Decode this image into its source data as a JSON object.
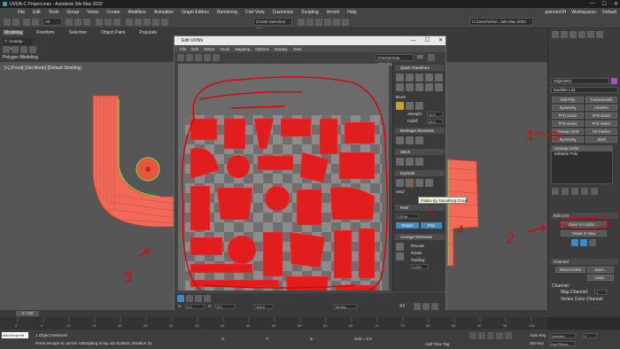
{
  "app": {
    "title": "UVDA-C Project.max - Autodesk 3ds Max 2022",
    "window_controls": [
      "—",
      "☐",
      "✕"
    ]
  },
  "menubar": {
    "items": [
      "File",
      "Edit",
      "Tools",
      "Group",
      "Views",
      "Create",
      "Modifiers",
      "Animation",
      "Graph Editors",
      "Rendering",
      "Civil View",
      "Customize",
      "Scripting",
      "Arnold",
      "Help"
    ],
    "sign_in": "plannerDH",
    "workspaces_label": "Workspaces:",
    "workspace_value": "Default"
  },
  "toolbar": {
    "filter": "All",
    "selection_set": "Create Selection Set",
    "project_path": "C:\\Users\\cherr...3ds Max 2022"
  },
  "ribbon": {
    "tabs": [
      "Modeling",
      "Freeform",
      "Selection",
      "Object Paint",
      "Populate"
    ],
    "active_tab": "Modeling",
    "polygon_modeling": "Polygon Modeling",
    "edit_label": "7. Unwrap UVW"
  },
  "viewport": {
    "label": "[+] [Front] [Std Mode] [Default Shading]"
  },
  "uv_editor": {
    "title": "Edit UVWs",
    "menu": [
      "File",
      "Edit",
      "Select",
      "Tools",
      "Mapping",
      "Options",
      "Display",
      "View"
    ],
    "texture_dropdown": "Checkermap (Checker)",
    "uv_label": "UV",
    "panels": {
      "quick_transform": "Quick Transform",
      "reshape_elements": "Reshape Elements",
      "stitch": "Stitch",
      "explode": "Explode",
      "peel": "Peel",
      "arrange_elements": "Arrange Elements"
    },
    "brush": "Brush",
    "strength_label": "Strength:",
    "strength_value": "10.0",
    "falloff_label": "Falloff:",
    "falloff_value": "20.0",
    "weld_label": "Weld",
    "peel_mode": "LSCM",
    "detach_label": "Detach",
    "pins_label": "Pins",
    "rescale_label": "Rescale",
    "rotate_label": "Rotate",
    "padding_label": "Padding:",
    "padding_value": "0.001",
    "bottom_u": "0.0",
    "bottom_v": "0.0",
    "zoom": "100.0",
    "all_ids": "All IDs",
    "xy_label": "XY",
    "tooltip": "Flatten By Smoothing Group"
  },
  "command_panel": {
    "object_name": "Object001",
    "modifier_list": "Modifier List",
    "buttons": [
      "Edit Poly",
      "TurboSmooth",
      "Symmetry",
      "Chamfer",
      "FFD 2x2x2",
      "FFD 3x3x3",
      "FFD 4x4x4",
      "FFD Select",
      "Unwrap UVW",
      "UV Packer",
      "Symmetry",
      "Shell"
    ],
    "stack": [
      "Unwrap UVW",
      "Editable Poly"
    ],
    "rollout_edit_uvs": "Edit UVs",
    "open_uv_editor": "Open UV Editor ...",
    "tweak_in_view": "Tweak In View",
    "rollout_channel": "Channel",
    "reset_uvws": "Reset UVWs",
    "save": "Save...",
    "load": "Load...",
    "channel_label": "Channel:",
    "map_channel": "Map Channel:",
    "map_channel_value": "1",
    "vertex_color": "Vertex Color Channel"
  },
  "timeline": {
    "frame": "0 / 100",
    "ticks": [
      "0",
      "5",
      "10",
      "15",
      "20",
      "25",
      "30",
      "35",
      "40",
      "45",
      "50",
      "55",
      "60",
      "65",
      "70",
      "75",
      "80",
      "85",
      "90",
      "95",
      "100"
    ]
  },
  "statusbar": {
    "selected": "1 Object Selected",
    "prompt": "Press escape to cancel. Attempting to lay out clusters. Iteration 31.",
    "maxscript": "MAXScript Mi",
    "x_label": "X:",
    "y_label": "Y:",
    "z_label": "Z:",
    "grid": "Grid = 0.0",
    "add_time_tag": "Add Time Tag",
    "auto_key": "Auto Key",
    "selected_mode": "Selected",
    "set_key": "Set Key",
    "key_filters": "Key Filters...",
    "frame_value": "0"
  },
  "annotations": {
    "numbers": [
      "1",
      "2",
      "3",
      "4"
    ],
    "color": "#e00000"
  },
  "colors": {
    "mesh": "#f26a57",
    "mesh_edge": "#c43a2a",
    "seam": "#7be040",
    "accent": "#3d8cc9",
    "annotation": "#e00000"
  }
}
